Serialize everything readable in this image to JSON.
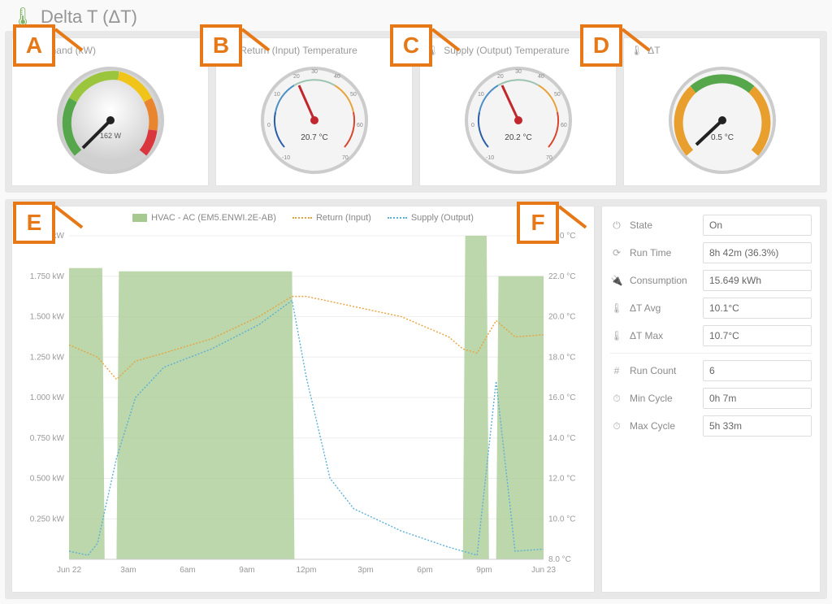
{
  "title": "Delta T (ΔT)",
  "callouts": [
    "A",
    "B",
    "C",
    "D",
    "E",
    "F"
  ],
  "gauges": [
    {
      "label": "Demand (kW)",
      "value": "162 W",
      "icon": "⚡"
    },
    {
      "label": "Return (Input) Temperature",
      "value": "20.7 °C",
      "icon": "🌡"
    },
    {
      "label": "Supply (Output) Temperature",
      "value": "20.2 °C",
      "icon": "🌡"
    },
    {
      "label": "ΔT",
      "value": "0.5 °C",
      "icon": "🌡"
    }
  ],
  "chart_data": {
    "type": "line",
    "title": "",
    "legend": [
      "HVAC - AC (EM5.ENWI.2E-AB)",
      "Return (Input)",
      "Supply (Output)"
    ],
    "x_categories": [
      "Jun 22",
      "3am",
      "6am",
      "9am",
      "12pm",
      "3pm",
      "6pm",
      "9pm",
      "Jun 23"
    ],
    "y1_label": "kW",
    "y1_ticks": [
      0.25,
      0.5,
      0.75,
      1.0,
      1.25,
      1.5,
      1.75,
      2.0
    ],
    "y2_label": "°C",
    "y2_ticks": [
      8.0,
      10.0,
      12.0,
      14.0,
      16.0,
      18.0,
      20.0,
      22.0,
      24.0
    ],
    "series": [
      {
        "name": "HVAC - AC (EM5.ENWI.2E-AB)",
        "axis": "y1",
        "type": "area",
        "color": "#a5c98f",
        "x": [
          0,
          0.07,
          0.075,
          0.1,
          0.105,
          0.47,
          0.475,
          0.83,
          0.835,
          0.88,
          0.885,
          0.9,
          0.905,
          1.0
        ],
        "y": [
          1.8,
          1.8,
          0,
          0,
          1.78,
          1.78,
          0,
          0,
          2.0,
          2.0,
          0,
          0,
          1.75,
          1.75
        ]
      },
      {
        "name": "Return (Input)",
        "axis": "y2",
        "type": "line",
        "color": "#e8a33d",
        "x": [
          0,
          0.06,
          0.1,
          0.14,
          0.2,
          0.3,
          0.4,
          0.47,
          0.5,
          0.6,
          0.7,
          0.8,
          0.83,
          0.86,
          0.9,
          0.94,
          1.0
        ],
        "y": [
          18.6,
          18.0,
          16.9,
          17.8,
          18.2,
          18.9,
          20.0,
          21.0,
          21.0,
          20.5,
          20.0,
          19.0,
          18.4,
          18.2,
          19.8,
          19.0,
          19.1
        ]
      },
      {
        "name": "Supply (Output)",
        "axis": "y2",
        "type": "line",
        "color": "#5bb0d8",
        "x": [
          0,
          0.04,
          0.06,
          0.1,
          0.14,
          0.2,
          0.3,
          0.4,
          0.47,
          0.5,
          0.55,
          0.6,
          0.7,
          0.8,
          0.83,
          0.86,
          0.9,
          0.94,
          1.0
        ],
        "y": [
          8.4,
          8.2,
          8.8,
          13.0,
          16.0,
          17.5,
          18.4,
          19.6,
          20.8,
          17.0,
          12.0,
          10.5,
          9.4,
          8.6,
          8.4,
          8.2,
          16.8,
          8.4,
          8.5
        ]
      }
    ]
  },
  "stats": {
    "state": {
      "label": "State",
      "value": "On",
      "icon": "⏻"
    },
    "runtime": {
      "label": "Run Time",
      "value": "8h 42m (36.3%)",
      "icon": "⟳"
    },
    "consumption": {
      "label": "Consumption",
      "value": "15.649 kWh",
      "icon": "🔌"
    },
    "dt_avg": {
      "label": "ΔT Avg",
      "value": "10.1°C",
      "icon": "🌡"
    },
    "dt_max": {
      "label": "ΔT Max",
      "value": "10.7°C",
      "icon": "🌡"
    },
    "run_count": {
      "label": "Run Count",
      "value": "6",
      "icon": "#"
    },
    "min_cycle": {
      "label": "Min Cycle",
      "value": "0h 7m",
      "icon": "⏱"
    },
    "max_cycle": {
      "label": "Max Cycle",
      "value": "5h 33m",
      "icon": "⏱"
    }
  }
}
